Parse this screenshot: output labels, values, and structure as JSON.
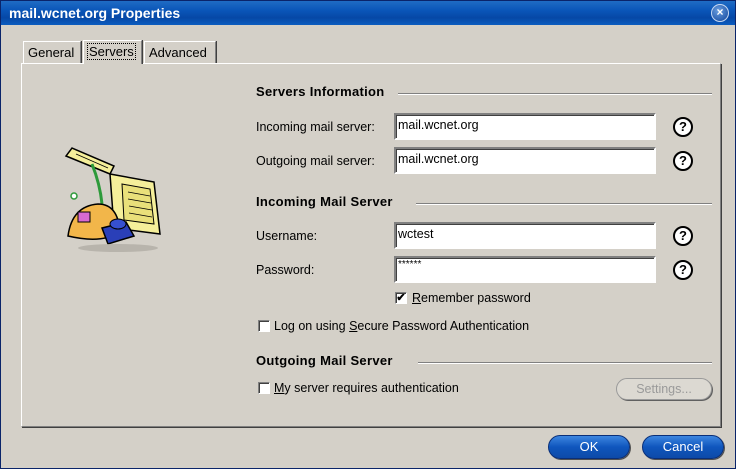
{
  "window": {
    "title": "mail.wcnet.org Properties",
    "close_glyph": "×"
  },
  "tabs": [
    {
      "label": "General"
    },
    {
      "label": "Servers",
      "active": true
    },
    {
      "label": "Advanced"
    }
  ],
  "servers_info": {
    "title": "Servers Information",
    "incoming_label": "Incoming mail server:",
    "incoming_value": "mail.wcnet.org",
    "outgoing_label": "Outgoing mail server:",
    "outgoing_value": "mail.wcnet.org"
  },
  "incoming_server": {
    "title": "Incoming Mail Server",
    "username_label": "Username:",
    "username_value": "wctest",
    "password_label": "Password:",
    "password_value": "******",
    "remember_label_pre": "",
    "remember_label_u": "R",
    "remember_label_post": "emember password",
    "remember_checked": true,
    "spa_label_pre": "Log on using ",
    "spa_label_u": "S",
    "spa_label_post": "ecure Password Authentication",
    "spa_checked": false
  },
  "outgoing_server": {
    "title": "Outgoing Mail Server",
    "auth_label_pre": "",
    "auth_label_u": "M",
    "auth_label_post": "y server requires authentication",
    "auth_checked": false,
    "settings_label": "Settings..."
  },
  "help_glyph": "?",
  "check_glyph": "✔",
  "buttons": {
    "ok": "OK",
    "cancel": "Cancel"
  },
  "colors": {
    "title_bar": "#0648a6",
    "button_blue": "#0f56bd",
    "dialog_bg": "#d4d0c8"
  },
  "icons": {
    "illustration": "mail-server-computer-icon"
  }
}
